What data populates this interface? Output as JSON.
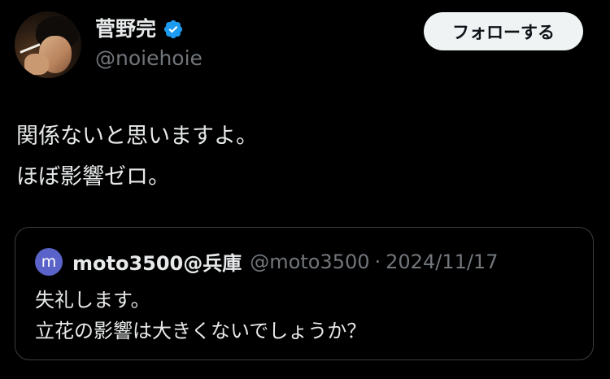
{
  "author": {
    "display_name": "菅野完",
    "handle": "@noiehoie",
    "verified": true,
    "avatar_icon": "user-photo-avatar"
  },
  "follow_button": {
    "label": "フォローする"
  },
  "tweet": {
    "lines": [
      "関係ないと思いますよ。",
      "ほぼ影響ゼロ。"
    ]
  },
  "quoted_tweet": {
    "avatar_letter": "m",
    "display_name": "moto3500@兵庫",
    "handle": "@moto3500",
    "separator": "·",
    "date": "2024/11/17",
    "lines": [
      "失礼します。",
      "立花の影響は大きくないでしょうか？"
    ]
  },
  "colors": {
    "background": "#000000",
    "primary_text": "#e7e9ea",
    "secondary_text": "#71767b",
    "verified_badge": "#1d9bf0",
    "quote_avatar": "#5a63c9",
    "quote_border": "#3a3e42",
    "follow_button_bg": "#eff3f4"
  }
}
